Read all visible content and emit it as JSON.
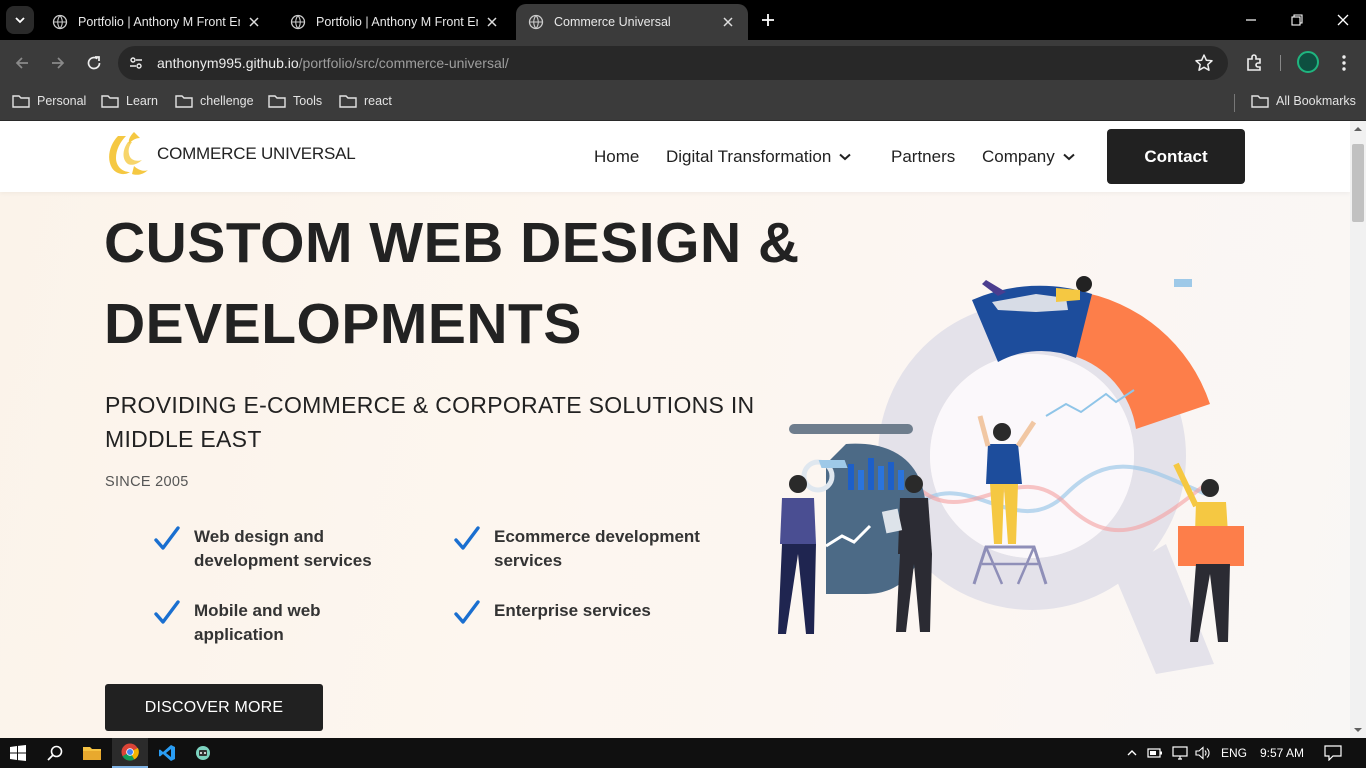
{
  "browser": {
    "tabs": [
      {
        "title": "Portfolio | Anthony M Front End Developer",
        "active": false
      },
      {
        "title": "Portfolio | Anthony M Front End Developer",
        "active": false
      },
      {
        "title": "Commerce Universal",
        "active": true
      }
    ],
    "address": {
      "host": "anthonym995.github.io",
      "path": "/portfolio/src/commerce-universal/"
    },
    "bookmarks": [
      "Personal",
      "Learn",
      "chellenge",
      "Tools",
      "react"
    ],
    "all_bookmarks": "All Bookmarks"
  },
  "site": {
    "logo_text": "COMMERCE UNIVERSAL",
    "nav": {
      "home": "Home",
      "digital": "Digital Transformation",
      "partners": "Partners",
      "company": "Company"
    },
    "contact": "Contact",
    "hero": {
      "title_line1": "CUSTOM WEB DESIGN &",
      "title_line2": "DEVELOPMENTS",
      "subtitle": "PROVIDING E-COMMERCE & CORPORATE SOLUTIONS IN MIDDLE EAST",
      "since": "SINCE 2005",
      "features": [
        "Web design and development services",
        "Ecommerce development services",
        "Mobile and web application",
        "Enterprise services"
      ],
      "cta": "DISCOVER MORE"
    }
  },
  "taskbar": {
    "lang": "ENG",
    "time": "9:57 AM"
  },
  "colors": {
    "accent_yellow": "#f5c842",
    "accent_orange": "#fd7e4a",
    "check_blue": "#1a6fd0",
    "dark": "#212121",
    "navy": "#1d4d9c"
  }
}
